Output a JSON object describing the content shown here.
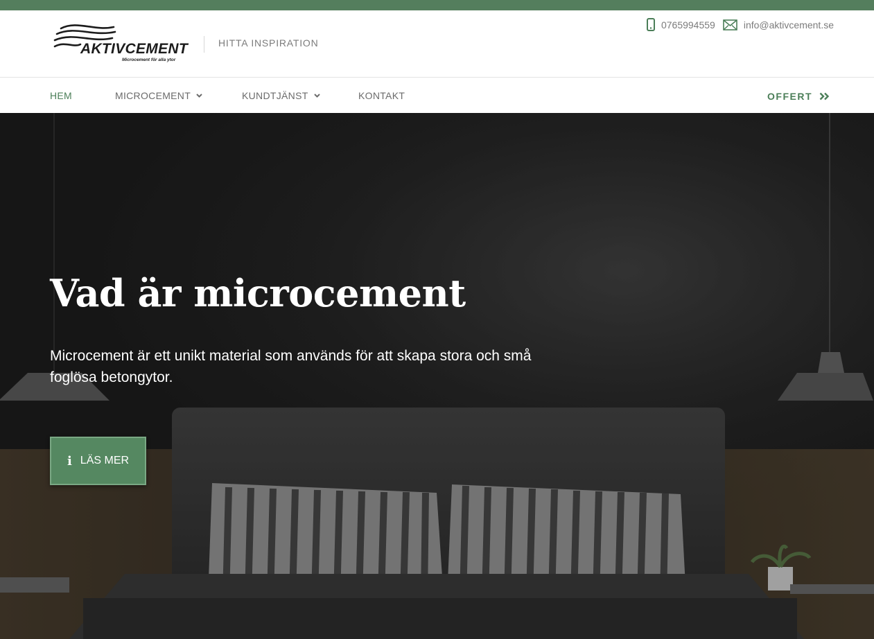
{
  "brand": {
    "name": "AKTIVCEMENT",
    "tagline": "Microcement för alla ytor",
    "accent_color": "#547e5d"
  },
  "header": {
    "inspiration_link": "HITTA INSPIRATION",
    "phone": {
      "icon": "phone-icon",
      "text": "0765994559"
    },
    "email": {
      "icon": "mail-icon",
      "text": "info@aktivcement.se"
    }
  },
  "nav": {
    "items": [
      {
        "label": "HEM",
        "active": true
      },
      {
        "label": "MICROCEMENT",
        "dropdown": true
      },
      {
        "label": "KUNDTJÄNST",
        "dropdown": true
      },
      {
        "label": "KONTAKT"
      }
    ],
    "cta": {
      "label": "OFFERT",
      "icon": "double-chevron-right-icon"
    }
  },
  "hero": {
    "title": "Vad är microcement",
    "text": "Microcement är ett unikt material som används för att skapa stora och små foglösa betongytor.",
    "button": {
      "label": "LÄS MER",
      "icon": "info-icon"
    }
  }
}
